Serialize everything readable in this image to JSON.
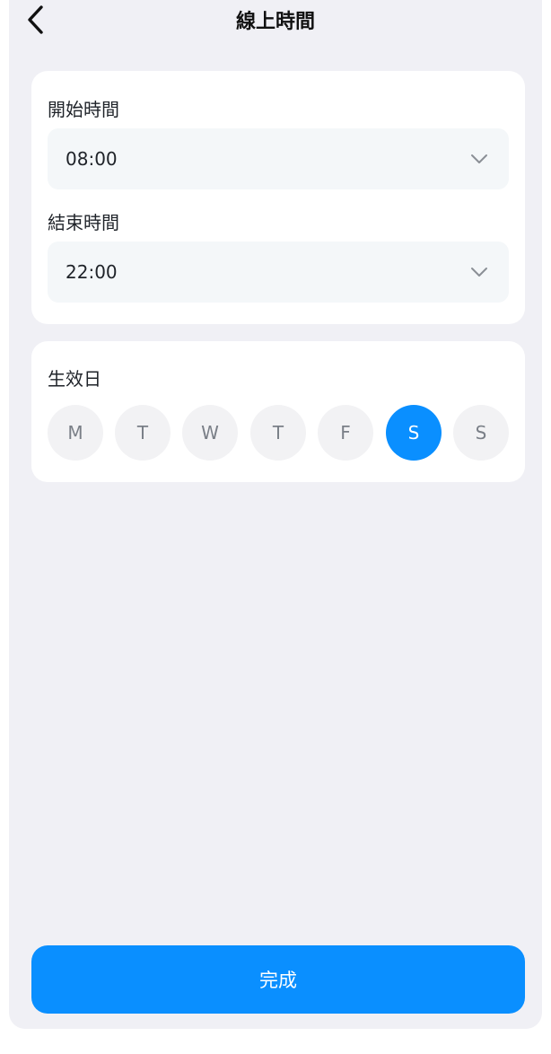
{
  "header": {
    "title": "線上時間",
    "back_icon": "chevron-left-icon"
  },
  "schedule": {
    "start": {
      "label": "開始時間",
      "value": "08:00"
    },
    "end": {
      "label": "結束時間",
      "value": "22:00"
    }
  },
  "days": {
    "label": "生效日",
    "items": [
      {
        "label": "M",
        "selected": false
      },
      {
        "label": "T",
        "selected": false
      },
      {
        "label": "W",
        "selected": false
      },
      {
        "label": "T",
        "selected": false
      },
      {
        "label": "F",
        "selected": false
      },
      {
        "label": "S",
        "selected": true
      },
      {
        "label": "S",
        "selected": false
      }
    ]
  },
  "footer": {
    "done_label": "完成"
  },
  "colors": {
    "accent": "#0a8fff",
    "background": "#f0f0f5",
    "card": "#ffffff",
    "field": "#f4f7f9",
    "day_inactive": "#f2f2f4"
  }
}
